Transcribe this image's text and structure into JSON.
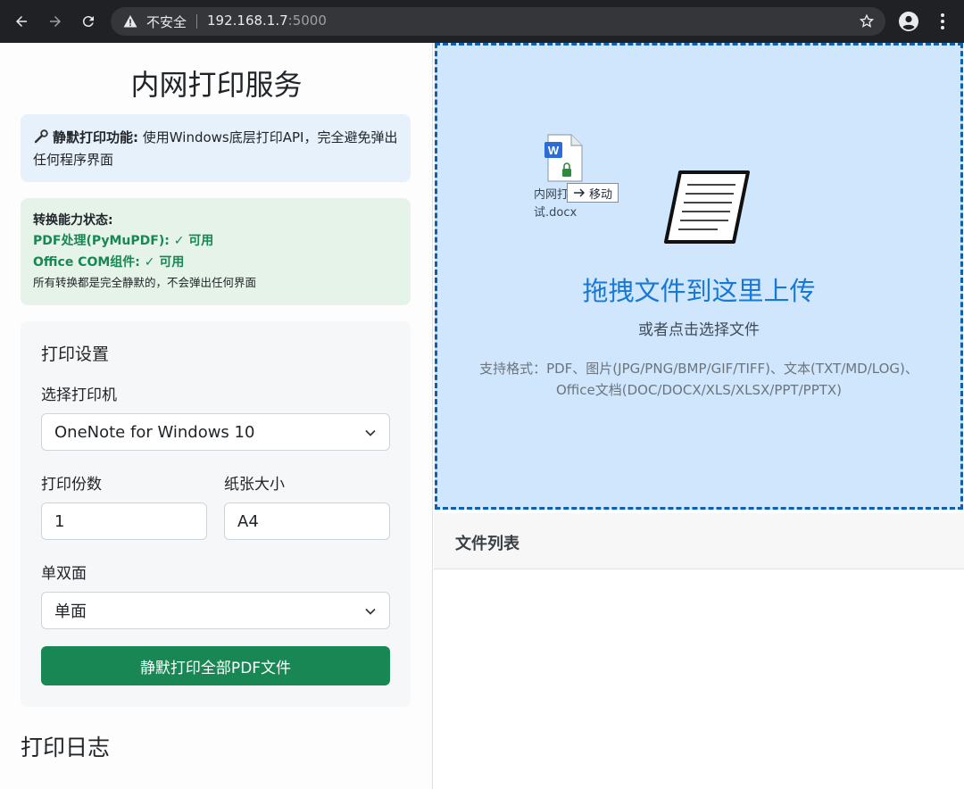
{
  "browser": {
    "security_label": "不安全",
    "url_host": "192.168.1.7",
    "url_port": ":5000"
  },
  "left": {
    "title": "内网打印服务",
    "info": {
      "bold": "静默打印功能:",
      "text": " 使用Windows底层打印API，完全避免弹出任何程序界面"
    },
    "status": {
      "title": "转换能力状态:",
      "pdf": "PDF处理(PyMuPDF): ✓ 可用",
      "office": "Office COM组件: ✓ 可用",
      "note": "所有转换都是完全静默的，不会弹出任何界面"
    },
    "settings": {
      "title": "打印设置",
      "printer_label": "选择打印机",
      "printer_value": "OneNote for Windows 10",
      "copies_label": "打印份数",
      "copies_value": "1",
      "paper_label": "纸张大小",
      "paper_value": "A4",
      "duplex_label": "单双面",
      "duplex_value": "单面",
      "print_button": "静默打印全部PDF文件"
    },
    "log_title": "打印日志"
  },
  "dropzone": {
    "dragged_file_name": "内网打\n试.docx",
    "move_tooltip": "移动",
    "title": "拖拽文件到这里上传",
    "subtitle": "或者点击选择文件",
    "formats_line1": "支持格式：PDF、图片(JPG/PNG/BMP/GIF/TIFF)、文本(TXT/MD/LOG)、",
    "formats_line2": "Office文档(DOC/DOCX/XLS/XLSX/PPT/PPTX)"
  },
  "file_list": {
    "title": "文件列表"
  },
  "colors": {
    "accent_green": "#198754",
    "drop_blue": "#1878d6",
    "drop_bg": "#cfe6fd"
  }
}
